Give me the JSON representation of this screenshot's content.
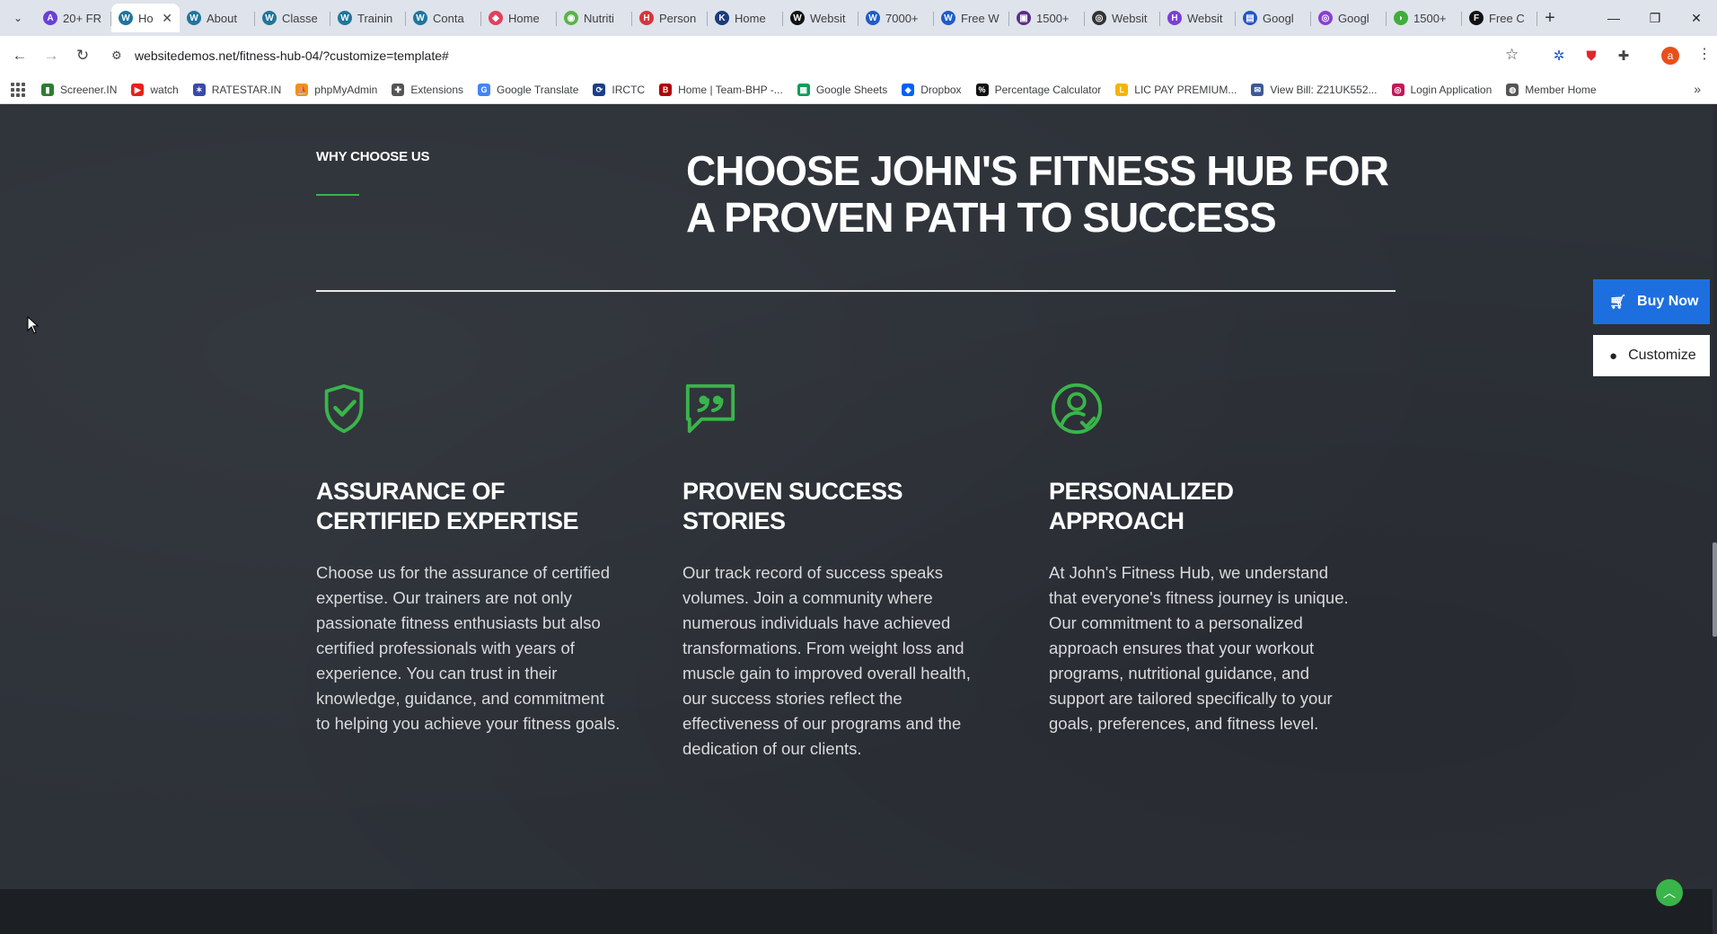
{
  "browser": {
    "tabs": [
      {
        "title": "20+ FR",
        "fav": "A",
        "color": "#6a3fd6"
      },
      {
        "title": "Ho",
        "fav": "W",
        "color": "#21759b",
        "active": true
      },
      {
        "title": "About",
        "fav": "W",
        "color": "#21759b"
      },
      {
        "title": "Classe",
        "fav": "W",
        "color": "#21759b"
      },
      {
        "title": "Trainin",
        "fav": "W",
        "color": "#21759b"
      },
      {
        "title": "Conta",
        "fav": "W",
        "color": "#21759b"
      },
      {
        "title": "Home",
        "fav": "◆",
        "color": "#e2405b"
      },
      {
        "title": "Nutriti",
        "fav": "◉",
        "color": "#5ab34a"
      },
      {
        "title": "Person",
        "fav": "H",
        "color": "#d9343a"
      },
      {
        "title": "Home",
        "fav": "K",
        "color": "#1a3b7a"
      },
      {
        "title": "Websit",
        "fav": "W",
        "color": "#111111"
      },
      {
        "title": "7000+",
        "fav": "W",
        "color": "#1e5cc7"
      },
      {
        "title": "Free W",
        "fav": "W",
        "color": "#1e5cc7"
      },
      {
        "title": "1500+",
        "fav": "▣",
        "color": "#5b2d86"
      },
      {
        "title": "Websit",
        "fav": "◎",
        "color": "#333333"
      },
      {
        "title": "Websit",
        "fav": "H",
        "color": "#7a3fd6"
      },
      {
        "title": "Googl",
        "fav": "▤",
        "color": "#2456c9"
      },
      {
        "title": "Googl",
        "fav": "◎",
        "color": "#8a3fd1"
      },
      {
        "title": "1500+",
        "fav": "◗",
        "color": "#3fae3a"
      },
      {
        "title": "Free C",
        "fav": "F",
        "color": "#111111"
      }
    ],
    "url": "websitedemos.net/fitness-hub-04/?customize=template#",
    "profile_initial": "a",
    "bookmarks": [
      {
        "label": "Screener.IN",
        "icon": "bar-chart-icon",
        "color": "#2e7d32",
        "glyph": "▮"
      },
      {
        "label": "watch",
        "icon": "youtube-icon",
        "color": "#e62117",
        "glyph": "▶"
      },
      {
        "label": "RATESTAR.IN",
        "icon": "ratestar-icon",
        "color": "#3949ab",
        "glyph": "✶"
      },
      {
        "label": "phpMyAdmin",
        "icon": "phpmyadmin-icon",
        "color": "#f29111",
        "glyph": "⛵"
      },
      {
        "label": "Extensions",
        "icon": "puzzle-icon",
        "color": "#555555",
        "glyph": "✚"
      },
      {
        "label": "Google Translate",
        "icon": "translate-icon",
        "color": "#4285f4",
        "glyph": "G"
      },
      {
        "label": "IRCTC",
        "icon": "irctc-icon",
        "color": "#1a3f8a",
        "glyph": "⟳"
      },
      {
        "label": "Home | Team-BHP -...",
        "icon": "teambhp-icon",
        "color": "#b00000",
        "glyph": "B"
      },
      {
        "label": "Google Sheets",
        "icon": "sheets-icon",
        "color": "#0f9d58",
        "glyph": "▦"
      },
      {
        "label": "Dropbox",
        "icon": "dropbox-icon",
        "color": "#0061fe",
        "glyph": "◆"
      },
      {
        "label": "Percentage Calculator",
        "icon": "percent-icon",
        "color": "#111111",
        "glyph": "%"
      },
      {
        "label": "LIC PAY PREMIUM...",
        "icon": "lic-icon",
        "color": "#f5b400",
        "glyph": "L"
      },
      {
        "label": "View Bill: Z21UK552...",
        "icon": "bill-icon",
        "color": "#3b5998",
        "glyph": "✉"
      },
      {
        "label": "Login Application",
        "icon": "login-icon",
        "color": "#c2185b",
        "glyph": "◎"
      },
      {
        "label": "Member Home",
        "icon": "globe-icon",
        "color": "#555555",
        "glyph": "◍"
      }
    ]
  },
  "page": {
    "eyebrow": "WHY CHOOSE US",
    "headline": "CHOOSE JOHN'S FITNESS HUB FOR A PROVEN PATH TO SUCCESS",
    "accent_color": "#39b54a",
    "features": [
      {
        "icon": "shield-check-icon",
        "title": "ASSURANCE OF CERTIFIED EXPERTISE",
        "body": "Choose us for the assurance of certified expertise. Our trainers are not only passionate fitness enthusiasts but also certified professionals with years of experience. You can trust in their knowledge, guidance, and commitment to helping you achieve your fitness goals."
      },
      {
        "icon": "quote-bubble-icon",
        "title": "PROVEN SUCCESS STORIES",
        "body": "Our track record of success speaks volumes. Join a community where numerous individuals have achieved transformations. From weight loss and muscle gain to improved overall health, our success stories reflect the effectiveness of our programs and the dedication of our clients."
      },
      {
        "icon": "user-check-icon",
        "title": "PERSONALIZED APPROACH",
        "body": "At John's Fitness Hub, we understand that everyone's fitness journey is unique. Our commitment to a personalized approach ensures that your workout programs, nutritional guidance, and support are tailored specifically to your goals, preferences, and fitness level."
      }
    ],
    "buy_now_label": "Buy Now",
    "customize_label": "Customize"
  }
}
